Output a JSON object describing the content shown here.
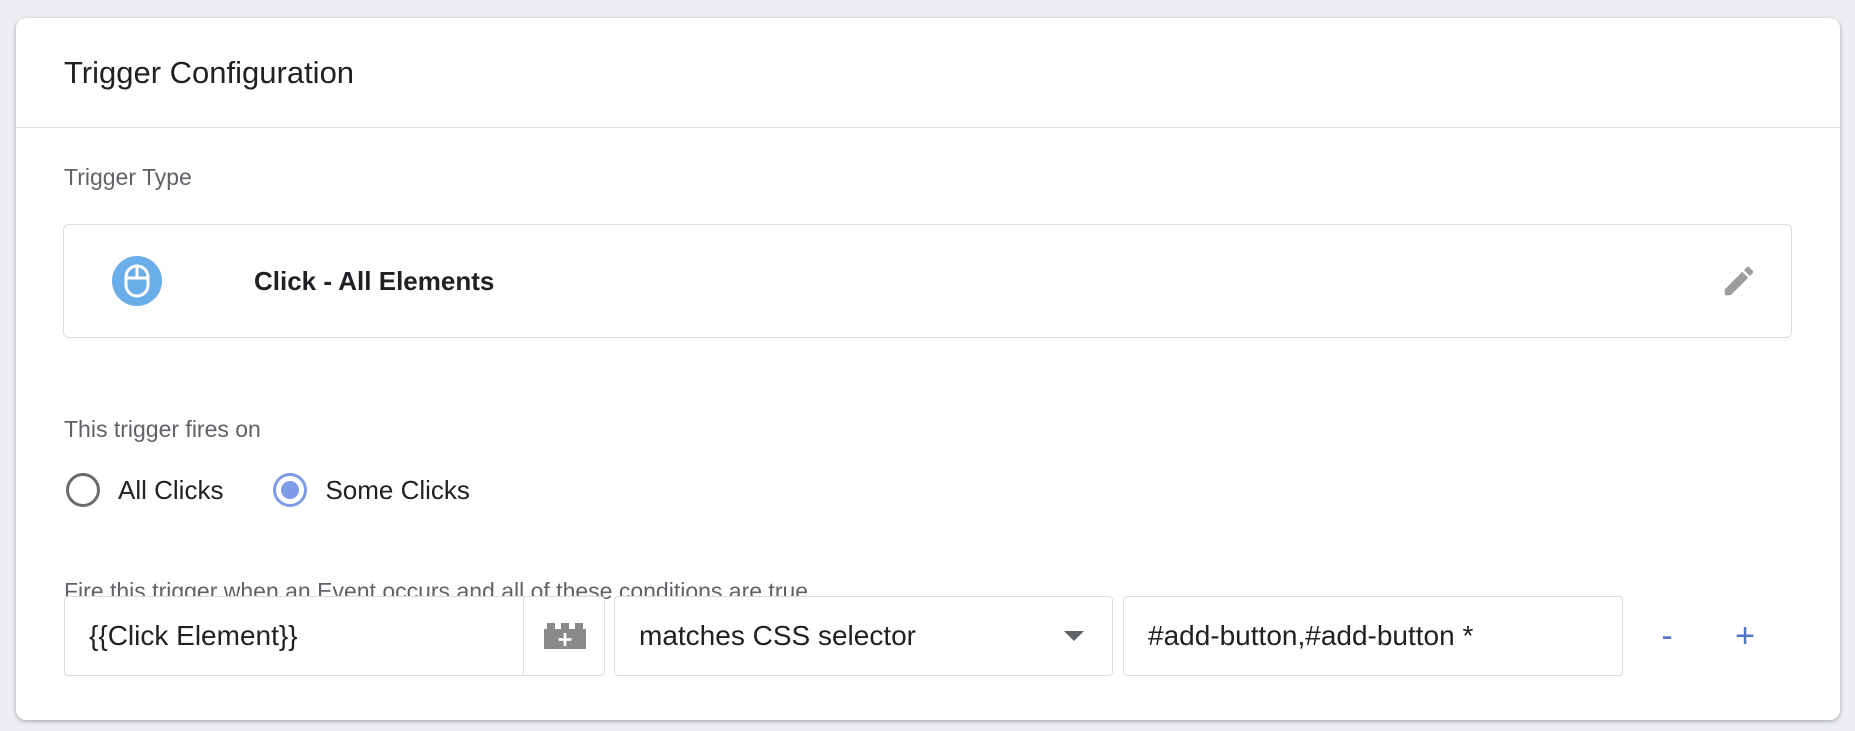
{
  "card": {
    "title": "Trigger Configuration"
  },
  "trigger_type": {
    "section_label": "Trigger Type",
    "name": "Click - All Elements",
    "icon": "mouse-icon",
    "icon_color": "#6aaee9",
    "edit_icon": "pencil-icon"
  },
  "fires_on": {
    "section_label": "This trigger fires on",
    "options": [
      {
        "label": "All Clicks",
        "selected": false
      },
      {
        "label": "Some Clicks",
        "selected": true
      }
    ],
    "accent_color": "#7e9be6"
  },
  "conditions": {
    "section_label": "Fire this trigger when an Event occurs and all of these conditions are true",
    "rows": [
      {
        "variable": "{{Click Element}}",
        "variable_icon": "building-block-add-icon",
        "operator": "matches CSS selector",
        "value": "#add-button,#add-button *",
        "remove_label": "-",
        "add_label": "+"
      }
    ],
    "action_color": "#4f74c8"
  }
}
